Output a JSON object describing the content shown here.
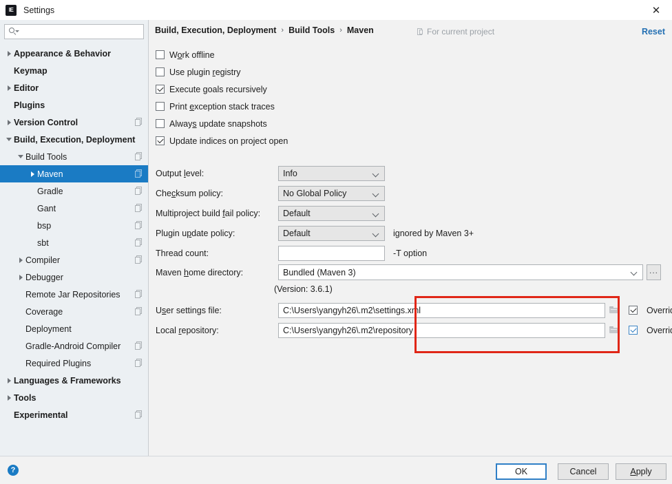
{
  "window": {
    "title": "Settings",
    "logo_text": "IE",
    "close_icon": "✕"
  },
  "sidebar": {
    "search": {
      "value": "",
      "placeholder": ""
    },
    "items": [
      {
        "label": "Appearance & Behavior",
        "indent": 0,
        "arrow": "right",
        "bold": true,
        "project_icon": false,
        "selected": false
      },
      {
        "label": "Keymap",
        "indent": 0,
        "arrow": "none",
        "bold": true,
        "project_icon": false,
        "selected": false
      },
      {
        "label": "Editor",
        "indent": 0,
        "arrow": "right",
        "bold": true,
        "project_icon": false,
        "selected": false
      },
      {
        "label": "Plugins",
        "indent": 0,
        "arrow": "none",
        "bold": true,
        "project_icon": false,
        "selected": false
      },
      {
        "label": "Version Control",
        "indent": 0,
        "arrow": "right",
        "bold": true,
        "project_icon": true,
        "selected": false
      },
      {
        "label": "Build, Execution, Deployment",
        "indent": 0,
        "arrow": "down",
        "bold": true,
        "project_icon": false,
        "selected": false
      },
      {
        "label": "Build Tools",
        "indent": 1,
        "arrow": "down",
        "bold": false,
        "project_icon": true,
        "selected": false
      },
      {
        "label": "Maven",
        "indent": 2,
        "arrow": "right",
        "bold": false,
        "project_icon": true,
        "selected": true
      },
      {
        "label": "Gradle",
        "indent": 2,
        "arrow": "none",
        "bold": false,
        "project_icon": true,
        "selected": false
      },
      {
        "label": "Gant",
        "indent": 2,
        "arrow": "none",
        "bold": false,
        "project_icon": true,
        "selected": false
      },
      {
        "label": "bsp",
        "indent": 2,
        "arrow": "none",
        "bold": false,
        "project_icon": true,
        "selected": false
      },
      {
        "label": "sbt",
        "indent": 2,
        "arrow": "none",
        "bold": false,
        "project_icon": true,
        "selected": false
      },
      {
        "label": "Compiler",
        "indent": 1,
        "arrow": "right",
        "bold": false,
        "project_icon": true,
        "selected": false
      },
      {
        "label": "Debugger",
        "indent": 1,
        "arrow": "right",
        "bold": false,
        "project_icon": false,
        "selected": false
      },
      {
        "label": "Remote Jar Repositories",
        "indent": 1,
        "arrow": "none",
        "bold": false,
        "project_icon": true,
        "selected": false
      },
      {
        "label": "Coverage",
        "indent": 1,
        "arrow": "none",
        "bold": false,
        "project_icon": true,
        "selected": false
      },
      {
        "label": "Deployment",
        "indent": 1,
        "arrow": "none",
        "bold": false,
        "project_icon": false,
        "selected": false
      },
      {
        "label": "Gradle-Android Compiler",
        "indent": 1,
        "arrow": "none",
        "bold": false,
        "project_icon": true,
        "selected": false
      },
      {
        "label": "Required Plugins",
        "indent": 1,
        "arrow": "none",
        "bold": false,
        "project_icon": true,
        "selected": false
      },
      {
        "label": "Languages & Frameworks",
        "indent": 0,
        "arrow": "right",
        "bold": true,
        "project_icon": false,
        "selected": false
      },
      {
        "label": "Tools",
        "indent": 0,
        "arrow": "right",
        "bold": true,
        "project_icon": false,
        "selected": false
      },
      {
        "label": "Experimental",
        "indent": 0,
        "arrow": "none",
        "bold": true,
        "project_icon": true,
        "selected": false
      }
    ]
  },
  "main": {
    "breadcrumb": [
      "Build, Execution, Deployment",
      "Build Tools",
      "Maven"
    ],
    "breadcrumb_separator": "›",
    "scope_note": "For current project",
    "reset_label": "Reset",
    "checkboxes": [
      {
        "label": "Work offline",
        "checked": false,
        "mnemonic": "o"
      },
      {
        "label": "Use plugin registry",
        "checked": false,
        "mnemonic": "r"
      },
      {
        "label": "Execute goals recursively",
        "checked": true,
        "mnemonic": "g"
      },
      {
        "label": "Print exception stack traces",
        "checked": false,
        "mnemonic": "e"
      },
      {
        "label": "Always update snapshots",
        "checked": false,
        "mnemonic": "s"
      },
      {
        "label": "Update indices on project open",
        "checked": true,
        "mnemonic": ""
      }
    ],
    "fields": [
      {
        "label": "Output level:",
        "type": "select",
        "value": "Info",
        "note": ""
      },
      {
        "label": "Checksum policy:",
        "type": "select",
        "value": "No Global Policy",
        "note": ""
      },
      {
        "label": "Multiproject build fail policy:",
        "type": "select",
        "value": "Default",
        "note": ""
      },
      {
        "label": "Plugin update policy:",
        "type": "select",
        "value": "Default",
        "note": "ignored by Maven 3+"
      },
      {
        "label": "Thread count:",
        "type": "input",
        "value": "",
        "note": "-T option"
      }
    ],
    "maven_home": {
      "label": "Maven home directory:",
      "value": "Bundled (Maven 3)",
      "browse_label": "...",
      "version_note": "(Version: 3.6.1)"
    },
    "paths": [
      {
        "label": "User settings file:",
        "value": "C:\\Users\\yangyh26\\.m2\\settings.xml",
        "override_label": "Override",
        "override_checked": true,
        "override_focused": false
      },
      {
        "label": "Local repository:",
        "value": "C:\\Users\\yangyh26\\.m2\\repository",
        "override_label": "Override",
        "override_checked": true,
        "override_focused": true
      }
    ]
  },
  "footer": {
    "help_glyph": "?",
    "ok_label": "OK",
    "cancel_label": "Cancel",
    "apply_label": "Apply"
  },
  "colors": {
    "selection_blue": "#1a7bc4",
    "link_blue": "#2470b3",
    "highlight_red": "#e02617",
    "sidebar_bg": "#ecf0f3",
    "panel_bg": "#f2f2f2"
  }
}
